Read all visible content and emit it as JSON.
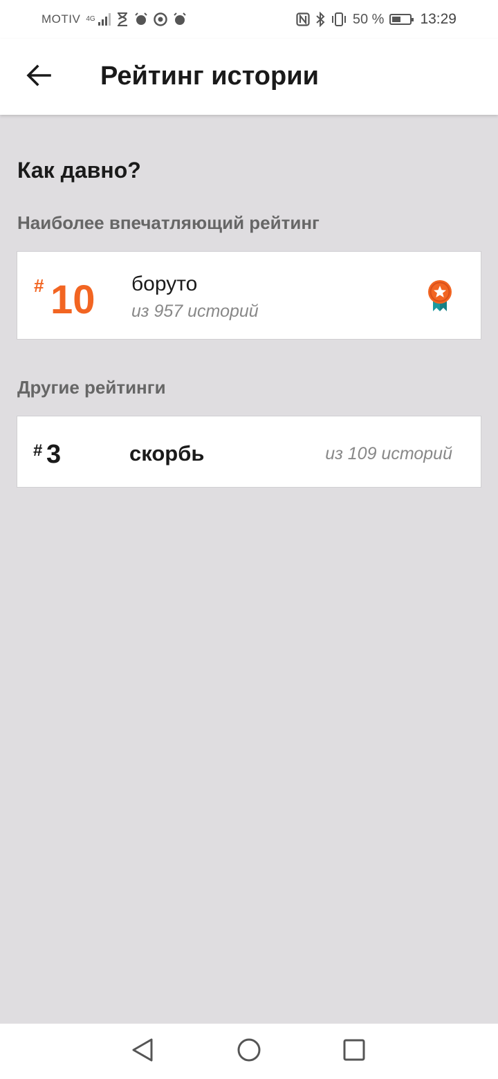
{
  "status_bar": {
    "carrier": "MOTIV",
    "network": "4G",
    "battery": "50 %",
    "battery_level": 0.5,
    "time": "13:29",
    "icons": [
      "signal-icon",
      "hourglass-icon",
      "alarm-icon",
      "chrome-icon",
      "alarm-icon",
      "nfc-icon",
      "bluetooth-icon",
      "vibrate-icon",
      "battery-icon"
    ]
  },
  "app_bar": {
    "title": "Рейтинг истории",
    "back_icon": "arrow-left-icon"
  },
  "content": {
    "heading": "Как давно?",
    "top_label": "Наиболее впечатляющий рейтинг",
    "top_ranking": {
      "hash": "#",
      "rank": "10",
      "tag": "боруто",
      "subtitle": "из 957 историй",
      "badge_icon": "medal-icon"
    },
    "other_label": "Другие рейтинги",
    "other_rankings": [
      {
        "hash": "#",
        "rank": "3",
        "tag": "скорбь",
        "subtitle": "из 109 историй"
      }
    ]
  },
  "nav_bar": {
    "buttons": [
      "nav-back-icon",
      "nav-home-icon",
      "nav-recent-icon"
    ]
  },
  "colors": {
    "accent": "#f26522",
    "badge_ribbon": "#1b9aa0",
    "background": "#dfdde0"
  }
}
